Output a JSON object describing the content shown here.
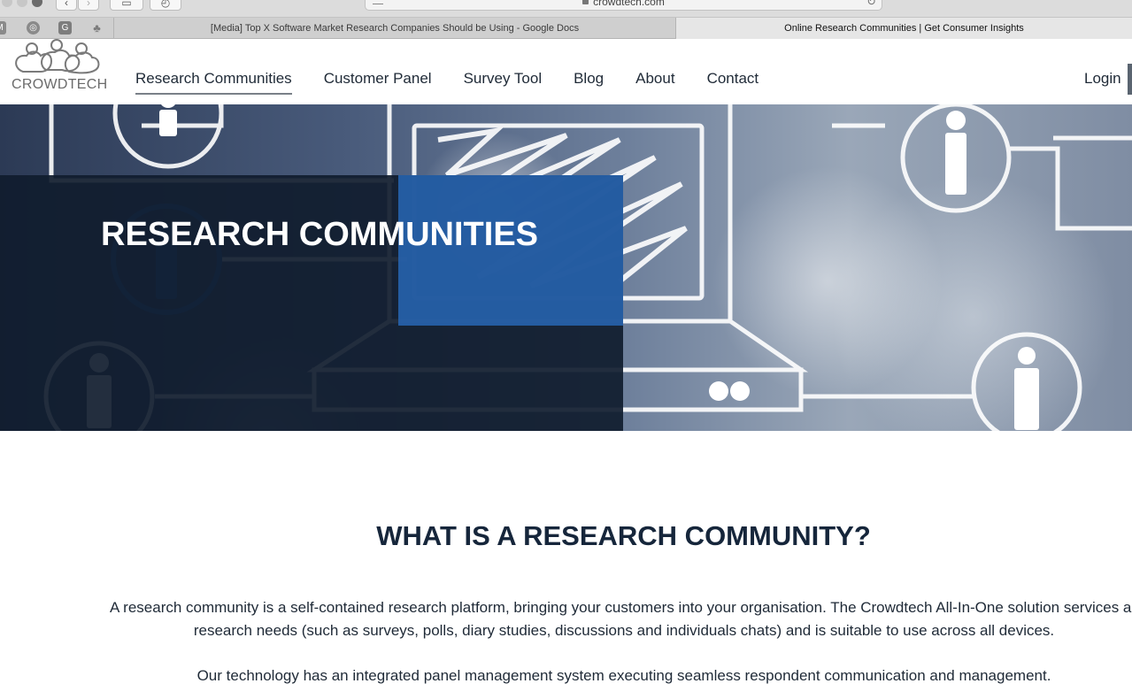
{
  "browser": {
    "url": "crowdtech.com",
    "tabs": [
      {
        "title": "[Media] Top X Software Market Research Companies Should be Using - Google Docs",
        "active": false
      },
      {
        "title": "Online Research Communities | Get Consumer Insights",
        "active": true
      }
    ],
    "bookmarks_icons": [
      "gmail-icon",
      "location-icon",
      "grammarly-icon",
      "people-icon"
    ]
  },
  "site": {
    "logo_text": "CROWDTECH",
    "nav": [
      {
        "label": "Research Communities",
        "active": true
      },
      {
        "label": "Customer Panel",
        "active": false
      },
      {
        "label": "Survey Tool",
        "active": false
      },
      {
        "label": "Blog",
        "active": false
      },
      {
        "label": "About",
        "active": false
      },
      {
        "label": "Contact",
        "active": false
      }
    ],
    "login_label": "Login"
  },
  "hero": {
    "title": "RESEARCH COMMUNITIES"
  },
  "content": {
    "heading": "WHAT IS A RESEARCH COMMUNITY?",
    "paragraph_1": "A research community is a self-contained research platform, bringing your customers into your organisation. The Crowdtech All-In-One solution services all research needs (such as surveys, polls, diary studies, discussions and individuals chats) and is suitable to use across all devices.",
    "paragraph_2": "Our technology has an integrated panel management system executing seamless respondent communication and management."
  },
  "colors": {
    "nav_text": "#1f2a37",
    "heading": "#16263b",
    "hero_overlay": "#101c2e",
    "hero_accent": "#2764b1"
  }
}
